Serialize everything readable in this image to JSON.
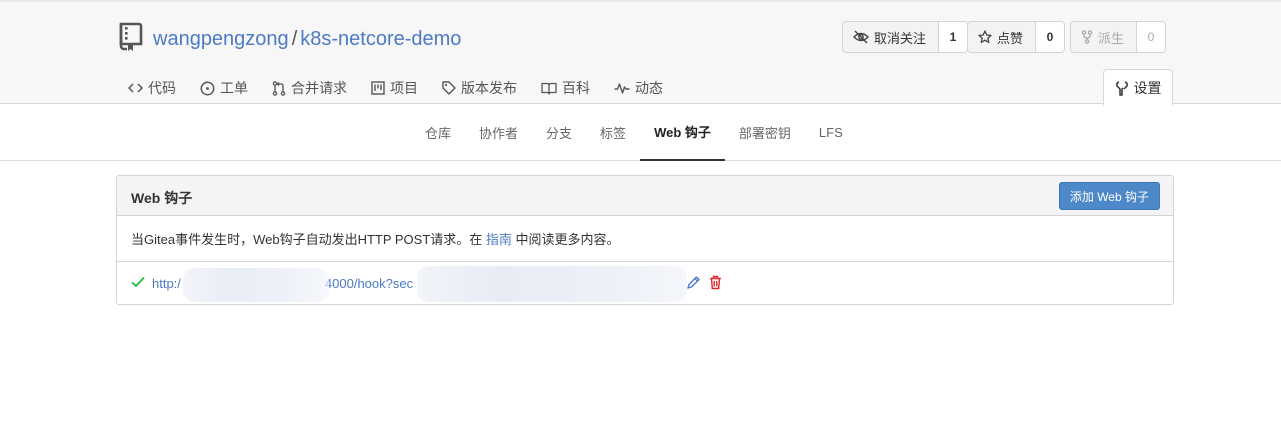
{
  "repo": {
    "owner": "wangpengzong",
    "separator": "/",
    "name": "k8s-netcore-demo"
  },
  "actions": {
    "unwatch": {
      "label": "取消关注",
      "count": "1"
    },
    "star": {
      "label": "点赞",
      "count": "0"
    },
    "fork": {
      "label": "派生",
      "count": "0"
    }
  },
  "nav": {
    "code": "代码",
    "issues": "工单",
    "pulls": "合并请求",
    "projects": "项目",
    "releases": "版本发布",
    "wiki": "百科",
    "activity": "动态",
    "settings": "设置"
  },
  "subnav": [
    "仓库",
    "协作者",
    "分支",
    "标签",
    "Web 钩子",
    "部署密钥",
    "LFS"
  ],
  "subnav_active": "Web 钩子",
  "panel": {
    "title": "Web 钩子",
    "add_button": "添加 Web 钩子",
    "desc_prefix": "当Gitea事件发生时，Web钩子自动发出HTTP POST请求。在 ",
    "desc_link": "指南",
    "desc_suffix": " 中阅读更多内容。"
  },
  "hook": {
    "url_start": "http:/",
    "url_mid": "4000/hook?sec"
  },
  "colors": {
    "link": "#4d7ac4",
    "primary_button": "#4d88c9",
    "success": "#21ba45",
    "danger": "#db2828"
  },
  "icons": [
    "repo-icon",
    "eye-slash-icon",
    "star-icon",
    "fork-icon",
    "code-icon",
    "issue-icon",
    "pull-request-icon",
    "project-icon",
    "tag-icon",
    "book-icon",
    "pulse-icon",
    "tools-icon",
    "check-icon",
    "pencil-icon",
    "trash-icon"
  ]
}
